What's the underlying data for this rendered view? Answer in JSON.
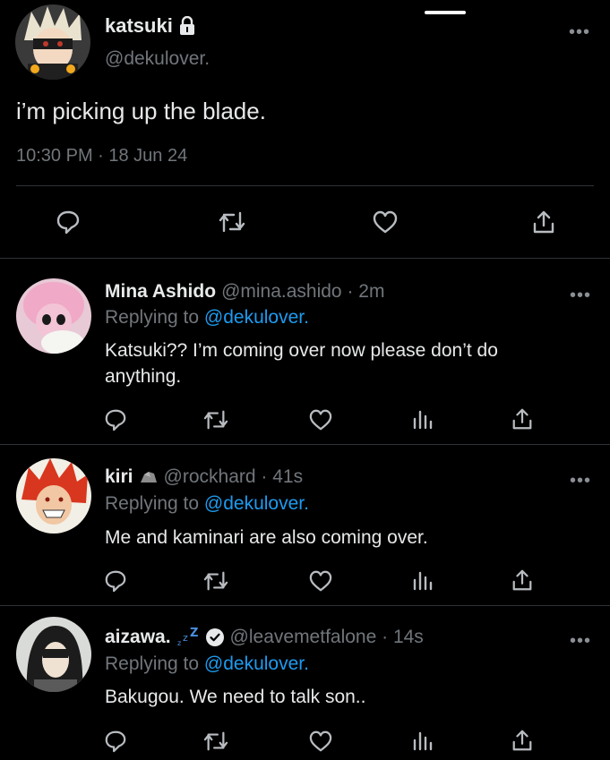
{
  "main_tweet": {
    "display_name": "katsuki",
    "handle": "@dekulover.",
    "text": "i’m picking up the blade.",
    "timestamp": "10:30 PM · 18 Jun 24",
    "lock_icon": "lock-icon",
    "actions": [
      "reply-icon",
      "retweet-icon",
      "like-icon",
      "share-icon"
    ]
  },
  "replies": [
    {
      "display_name": "Mina Ashido",
      "handle_time": "@mina.ashido · 2m",
      "replying_prefix": "Replying to",
      "replying_to": "@dekulover.",
      "text": "Katsuki?? I’m coming over now please don’t do anything."
    },
    {
      "display_name": "kiri",
      "badge": "rock-emoji",
      "handle_time": "@rockhard · 41s",
      "replying_prefix": "Replying to",
      "replying_to": "@dekulover.",
      "text": "Me and kaminari are also coming over."
    },
    {
      "display_name": "aizawa.",
      "badge": "zzz-emoji",
      "verified": "verified-icon",
      "handle_time": "@leavemetfalone · 14s",
      "replying_prefix": "Replying to",
      "replying_to": "@dekulover.",
      "text": "Bakugou. We need to talk son.."
    }
  ],
  "more_label": "•••",
  "colors": {
    "background": "#000000",
    "text": "#e7e9ea",
    "muted": "#71767b",
    "link": "#1d9bf0",
    "divider": "#2f3336"
  }
}
